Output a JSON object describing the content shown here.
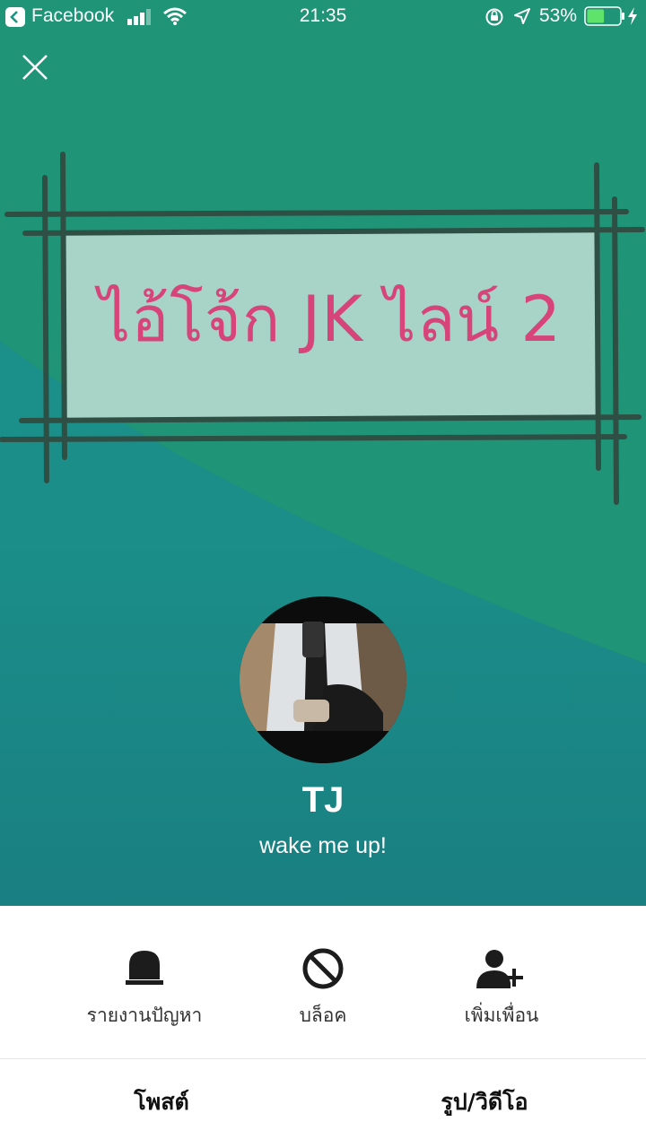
{
  "status_bar": {
    "back_app": "Facebook",
    "time": "21:35",
    "battery": "53%",
    "battery_level": 0.53
  },
  "cover": {
    "banner_text": "ไอ้โจ้ก JK ไลน์ 2"
  },
  "profile": {
    "name": "TJ",
    "status_message": "wake me up!"
  },
  "actions": [
    {
      "label": "รายงานปัญหา",
      "icon": "alarm-icon"
    },
    {
      "label": "บล็อค",
      "icon": "block-icon"
    },
    {
      "label": "เพิ่มเพื่อน",
      "icon": "add-friend-icon"
    }
  ],
  "tabs": [
    {
      "label": "โพสต์"
    },
    {
      "label": "รูป/วิดีโอ"
    }
  ],
  "colors": {
    "cover_green": "#1e9482",
    "banner_fill": "#a7d4c6",
    "banner_text": "#d6447a",
    "frame_lines": "#2f4f45"
  }
}
